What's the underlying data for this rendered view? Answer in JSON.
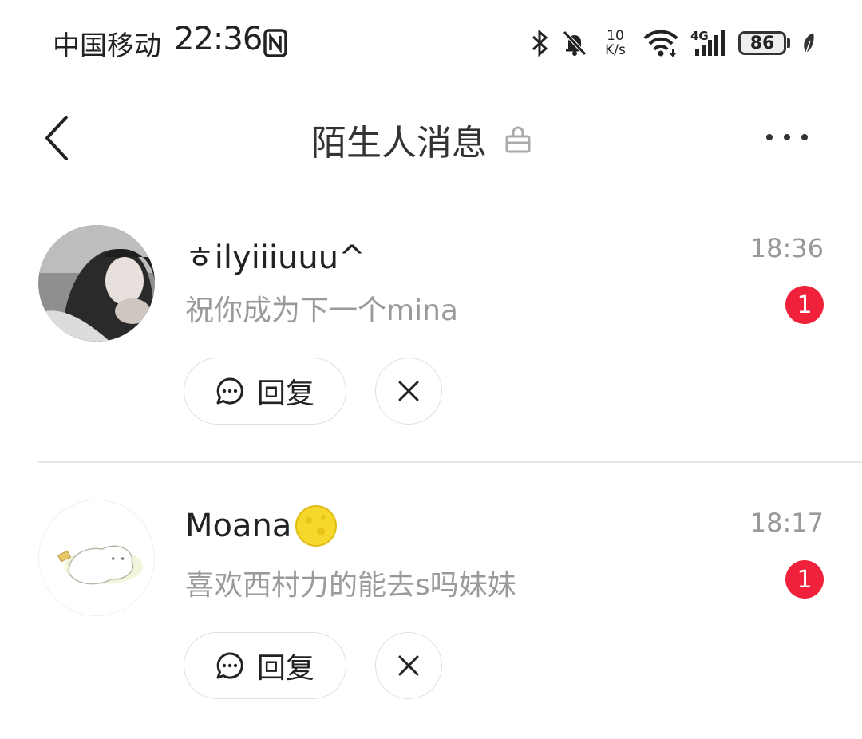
{
  "status_bar": {
    "carrier": "中国移动",
    "time": "22:36",
    "net_speed_value": "10",
    "net_speed_unit": "K/s",
    "network_type": "4G",
    "battery": "86"
  },
  "header": {
    "title": "陌生人消息"
  },
  "messages": [
    {
      "name": "ㅎilyiiiuuu^",
      "preview": "祝你成为下一个mina",
      "time": "18:36",
      "unread": "1",
      "reply_label": "回复"
    },
    {
      "name": "Moana",
      "preview": "喜欢西村力的能去s吗妹妹",
      "time": "18:17",
      "unread": "1",
      "reply_label": "回复"
    }
  ],
  "colors": {
    "badge": "#f0213a",
    "secondary_text": "#9a9a9a",
    "divider": "#e6e6e6"
  }
}
